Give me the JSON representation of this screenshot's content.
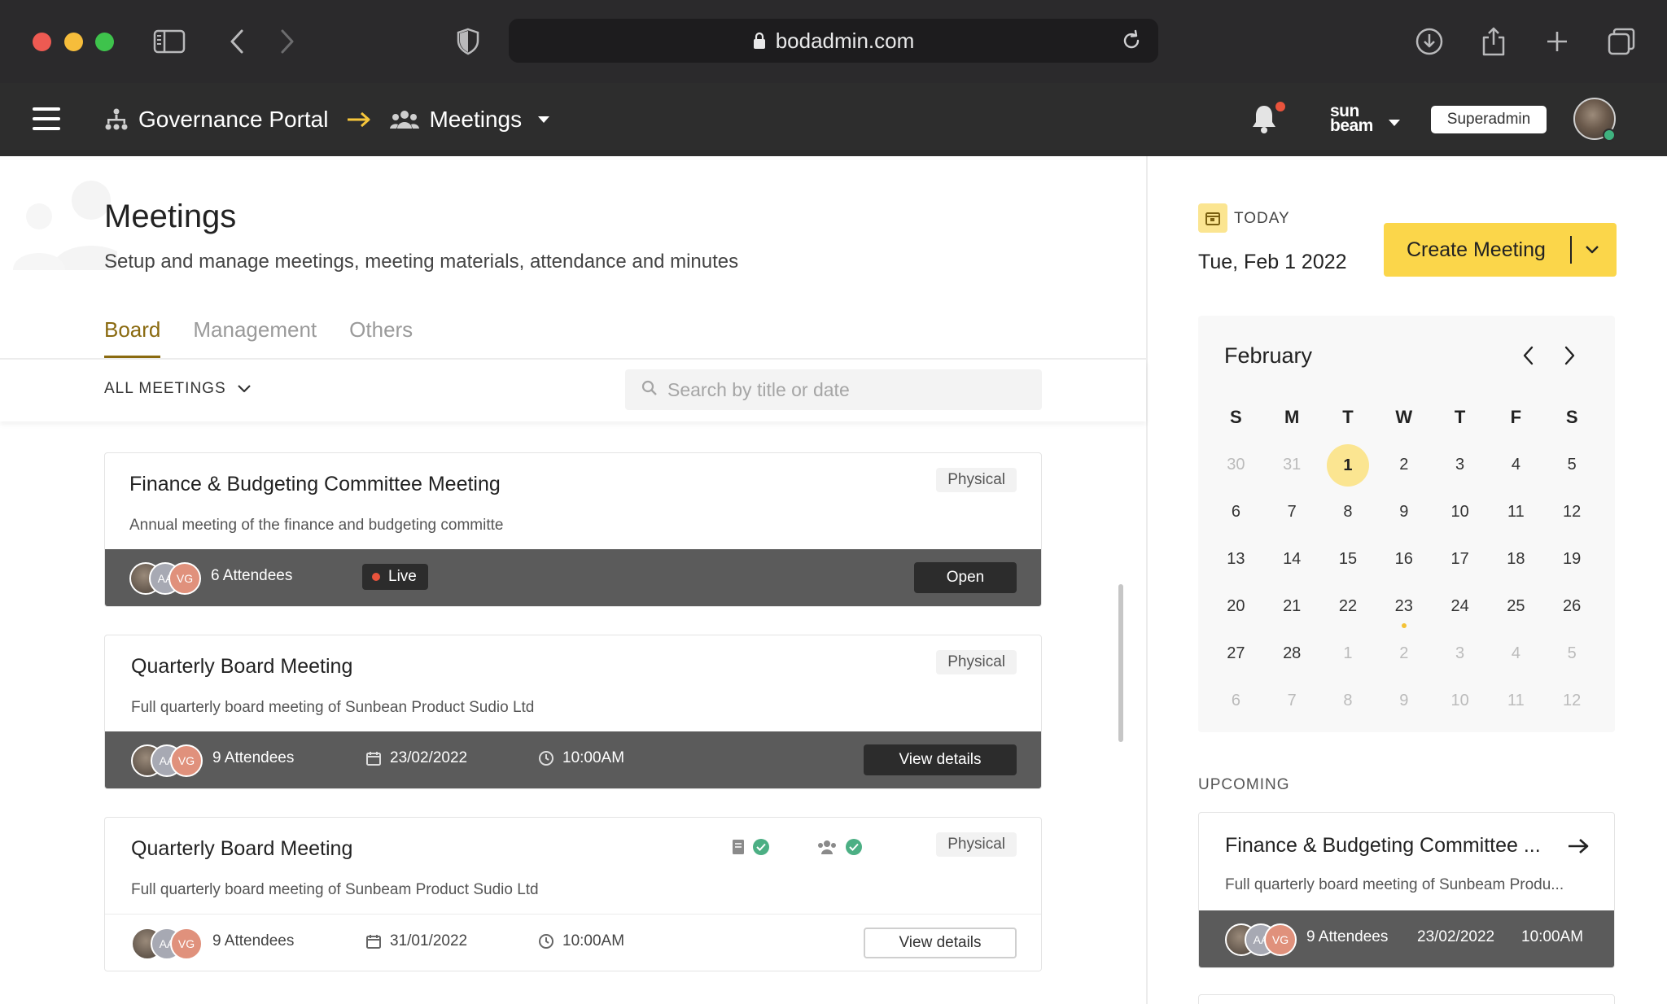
{
  "browser": {
    "url": "bodadmin.com"
  },
  "header": {
    "portal": "Governance Portal",
    "section": "Meetings",
    "brand_line1": "sun",
    "brand_line2": "beam",
    "role": "Superadmin"
  },
  "page": {
    "title": "Meetings",
    "subtitle": "Setup and manage meetings, meeting materials, attendance and minutes",
    "tabs": [
      {
        "label": "Board",
        "active": true
      },
      {
        "label": "Management",
        "active": false
      },
      {
        "label": "Others",
        "active": false
      }
    ],
    "filter": "ALL MEETINGS",
    "search_placeholder": "Search by title or date"
  },
  "meetings": [
    {
      "title": "Finance & Budgeting Committee Meeting",
      "description": "Annual meeting of the finance and budgeting committe",
      "type": "Physical",
      "avatars": [
        "",
        "AA",
        "VG"
      ],
      "attendees": "6 Attendees",
      "status": "Live",
      "action": "Open"
    },
    {
      "title": "Quarterly Board Meeting",
      "description": "Full quarterly board meeting of Sunbean Product Sudio Ltd",
      "type": "Physical",
      "avatars": [
        "",
        "AA",
        "VG"
      ],
      "attendees": "9 Attendees",
      "date": "23/02/2022",
      "time": "10:00AM",
      "action": "View details"
    },
    {
      "title": "Quarterly Board Meeting",
      "description": "Full quarterly board meeting of Sunbeam Product Sudio Ltd",
      "type": "Physical",
      "avatars": [
        "",
        "AA",
        "VG"
      ],
      "attendees": "9 Attendees",
      "date": "31/01/2022",
      "time": "10:00AM",
      "action": "View details"
    }
  ],
  "sidebar": {
    "today_label": "TODAY",
    "today_date": "Tue, Feb 1 2022",
    "create_label": "Create Meeting",
    "calendar": {
      "month": "February",
      "weekdays": [
        "S",
        "M",
        "T",
        "W",
        "T",
        "F",
        "S"
      ],
      "weeks": [
        [
          "30",
          "31",
          "1",
          "2",
          "3",
          "4",
          "5"
        ],
        [
          "6",
          "7",
          "8",
          "9",
          "10",
          "11",
          "12"
        ],
        [
          "13",
          "14",
          "15",
          "16",
          "17",
          "18",
          "19"
        ],
        [
          "20",
          "21",
          "22",
          "23",
          "24",
          "25",
          "26"
        ],
        [
          "27",
          "28",
          "1",
          "2",
          "3",
          "4",
          "5"
        ],
        [
          "6",
          "7",
          "8",
          "9",
          "10",
          "11",
          "12"
        ]
      ],
      "selected_day": "1",
      "event_day": "23"
    },
    "upcoming_label": "UPCOMING",
    "upcoming": {
      "title": "Finance & Budgeting Committee ...",
      "description": "Full quarterly board meeting of Sunbeam Produ...",
      "avatars": [
        "",
        "AA",
        "VG"
      ],
      "attendees": "9 Attendees",
      "date": "23/02/2022",
      "time": "10:00AM"
    }
  },
  "colors": {
    "accent_yellow": "#fbd64a",
    "tab_active": "#8a6a10",
    "live_red": "#e9533c",
    "check_green": "#4caf84"
  }
}
